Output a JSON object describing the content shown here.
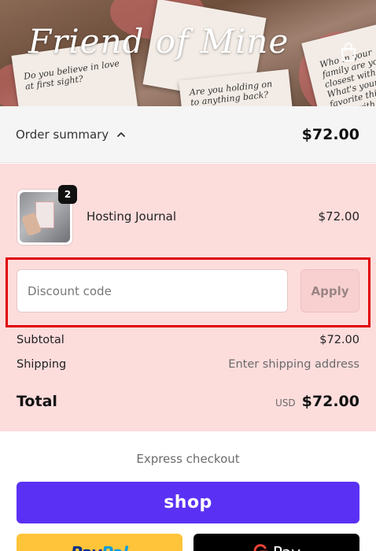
{
  "header": {
    "logo_text": "Friend of Mine",
    "card_texts": [
      "Do you believe in love at first sight?",
      "Who in your family are you closest with? What's your favorite thing to do with them?",
      "Are you holding on to anything back?"
    ]
  },
  "order_summary": {
    "toggle_label": "Order summary",
    "total": "$72.00"
  },
  "product": {
    "name": "Hosting Journal",
    "price": "$72.00",
    "quantity": "2"
  },
  "discount": {
    "placeholder": "Discount code",
    "apply_label": "Apply"
  },
  "totals": {
    "subtotal_label": "Subtotal",
    "subtotal_value": "$72.00",
    "shipping_label": "Shipping",
    "shipping_value": "Enter shipping address",
    "total_label": "Total",
    "currency": "USD",
    "total_value": "$72.00"
  },
  "express": {
    "label": "Express checkout",
    "shop_label": "shop",
    "paypal_label_1": "Pay",
    "paypal_label_2": "Pal",
    "gpay_label": "Pay"
  },
  "colors": {
    "panel_bg": "#fddcdc",
    "shop_purple": "#5a31f4",
    "paypal_yellow": "#ffc43a",
    "highlight_red": "#e00000"
  }
}
